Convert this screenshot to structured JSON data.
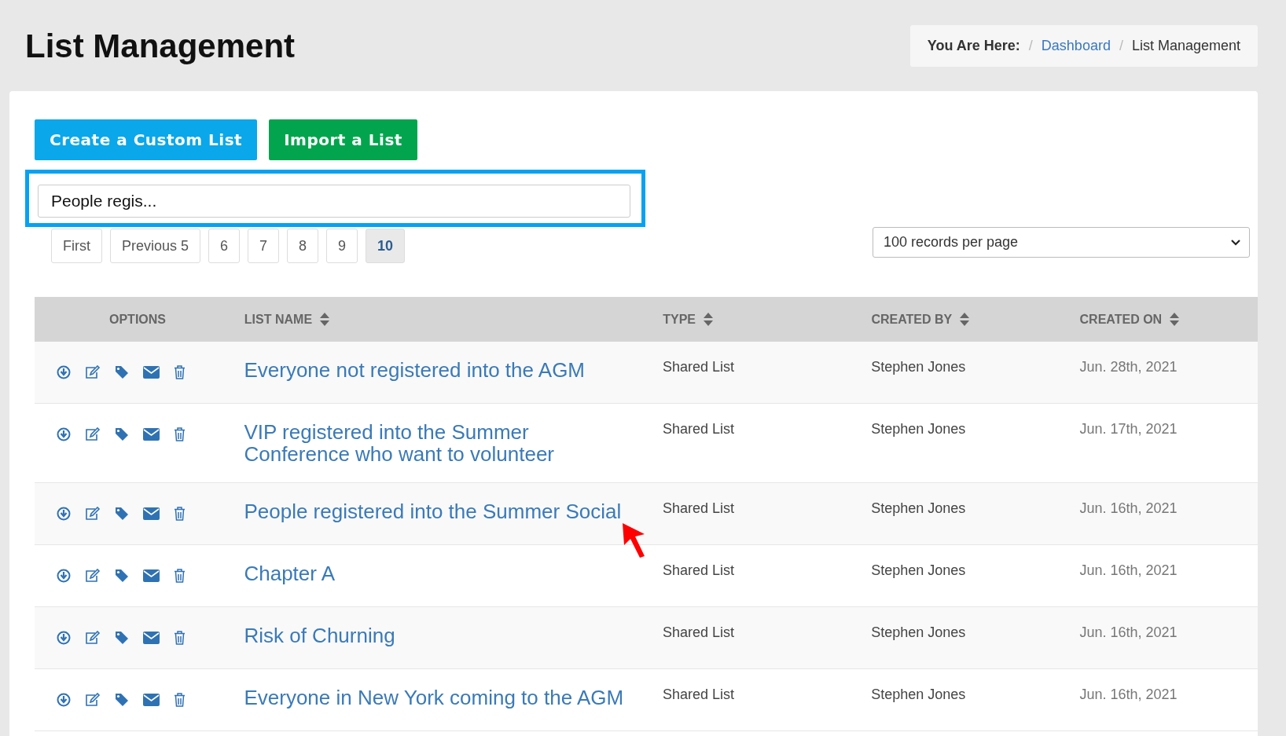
{
  "page_title": "List Management",
  "breadcrumb": {
    "label": "You Are Here:",
    "separator": "/",
    "items": [
      {
        "text": "Dashboard",
        "link": true
      },
      {
        "text": "List Management",
        "link": false
      }
    ]
  },
  "actions": [
    {
      "label": "Create a Custom List",
      "kind": "primary"
    },
    {
      "label": "Import a List",
      "kind": "success"
    }
  ],
  "search": {
    "value": "People regis...",
    "highlighted": true
  },
  "pagination": [
    {
      "label": "First",
      "selected": false
    },
    {
      "label": "Previous 5",
      "selected": false
    },
    {
      "label": "6",
      "selected": false
    },
    {
      "label": "7",
      "selected": false
    },
    {
      "label": "8",
      "selected": false
    },
    {
      "label": "9",
      "selected": false
    },
    {
      "label": "10",
      "selected": true
    }
  ],
  "page_size": {
    "value": "100 records per page"
  },
  "table": {
    "columns": [
      {
        "label": "OPTIONS",
        "sortable": false
      },
      {
        "label": "LIST NAME",
        "sortable": true
      },
      {
        "label": "TYPE",
        "sortable": true
      },
      {
        "label": "CREATED BY",
        "sortable": true
      },
      {
        "label": "CREATED ON",
        "sortable": true
      }
    ],
    "rows": [
      {
        "name": "Everyone not registered into the AGM",
        "type": "Shared List",
        "created_by": "Stephen Jones",
        "created_on": "Jun. 28th, 2021"
      },
      {
        "name": "VIP registered into the Summer Conference who want to volunteer",
        "type": "Shared List",
        "created_by": "Stephen Jones",
        "created_on": "Jun. 17th, 2021"
      },
      {
        "name": "People registered into the Summer Social",
        "type": "Shared List",
        "created_by": "Stephen Jones",
        "created_on": "Jun. 16th, 2021"
      },
      {
        "name": "Chapter A",
        "type": "Shared List",
        "created_by": "Stephen Jones",
        "created_on": "Jun. 16th, 2021"
      },
      {
        "name": "Risk of Churning",
        "type": "Shared List",
        "created_by": "Stephen Jones",
        "created_on": "Jun. 16th, 2021"
      },
      {
        "name": "Everyone in New York coming to the AGM",
        "type": "Shared List",
        "created_by": "Stephen Jones",
        "created_on": "Jun. 16th, 2021"
      }
    ]
  }
}
